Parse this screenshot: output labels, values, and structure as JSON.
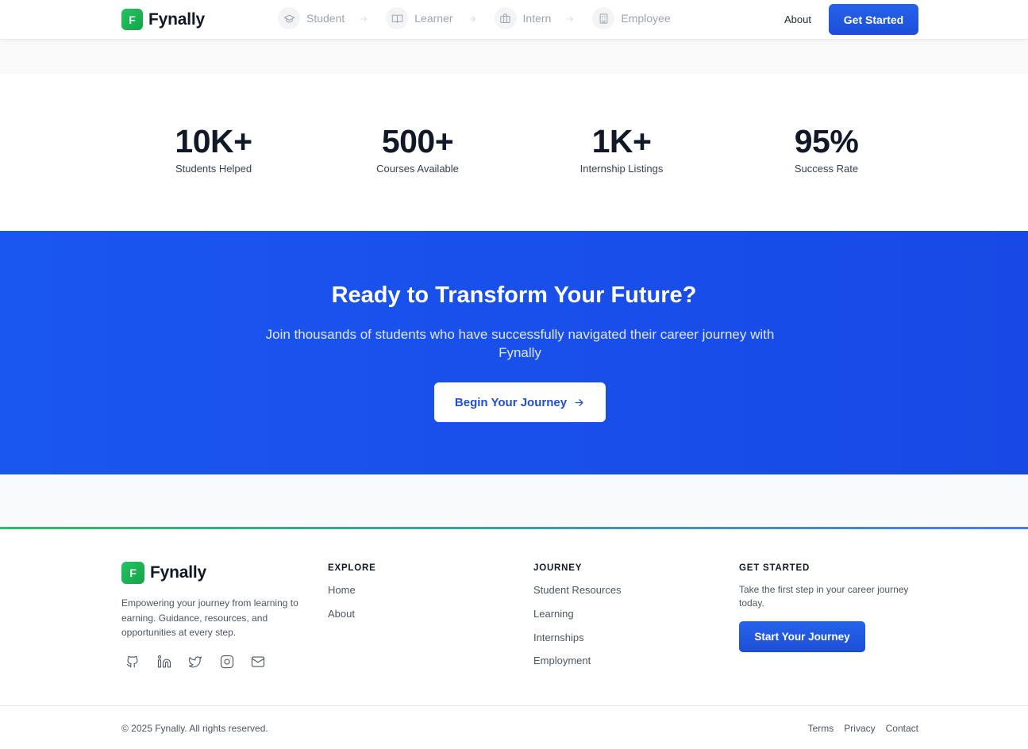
{
  "brand": {
    "initial": "F",
    "name": "Fynally"
  },
  "header": {
    "steps": [
      {
        "label": "Student",
        "icon": "graduation-cap-icon"
      },
      {
        "label": "Learner",
        "icon": "book-open-icon"
      },
      {
        "label": "Intern",
        "icon": "briefcase-icon"
      },
      {
        "label": "Employee",
        "icon": "building-icon"
      }
    ],
    "about_label": "About",
    "cta_label": "Get Started"
  },
  "stats": [
    {
      "value": "10K+",
      "label": "Students Helped"
    },
    {
      "value": "500+",
      "label": "Courses Available"
    },
    {
      "value": "1K+",
      "label": "Internship Listings"
    },
    {
      "value": "95%",
      "label": "Success Rate"
    }
  ],
  "cta": {
    "title": "Ready to Transform Your Future?",
    "subtitle": "Join thousands of students who have successfully navigated their career journey with Fynally",
    "button_label": "Begin Your Journey"
  },
  "footer": {
    "description": "Empowering your journey from learning to earning. Guidance, resources, and opportunities at every step.",
    "socials": [
      "github-icon",
      "linkedin-icon",
      "twitter-icon",
      "instagram-icon",
      "mail-icon"
    ],
    "explore": {
      "title": "EXPLORE",
      "links": [
        "Home",
        "About"
      ]
    },
    "journey": {
      "title": "JOURNEY",
      "links": [
        "Student Resources",
        "Learning",
        "Internships",
        "Employment"
      ]
    },
    "get_started": {
      "title": "GET STARTED",
      "text": "Take the first step in your career journey today.",
      "button_label": "Start Your Journey"
    },
    "copyright": "© 2025 Fynally. All rights reserved.",
    "bottom_links": [
      "Terms",
      "Privacy",
      "Contact"
    ]
  },
  "colors": {
    "primary": "#1d4ed8",
    "cta_bg": "#1a56ee",
    "brand_green": "#22c55e"
  }
}
